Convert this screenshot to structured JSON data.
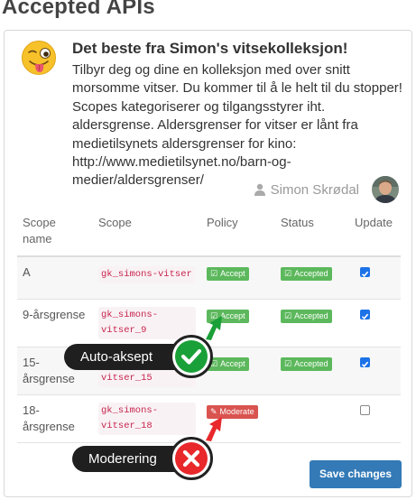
{
  "page": {
    "title": "Accepted APIs"
  },
  "api": {
    "title": "Det beste fra Simon's vitsekolleksjon!",
    "description": "Tilbyr deg og dine en kolleksjon med over snitt morsomme vitser. Du kommer til å le helt til du stopper! Scopes kategoriserer og tilgangsstyrer iht. aldersgrense. Aldersgrenser for vitser er lånt fra medietilsynets aldersgrenser for kino: http://www.medietilsynet.no/barn-og-medier/aldersgrenser/",
    "owner": "Simon Skrødal",
    "emoji_icon": "winking-tongue-emoji-icon"
  },
  "table": {
    "headers": {
      "scope_name": "Scope name",
      "scope": "Scope",
      "policy": "Policy",
      "status": "Status",
      "update": "Update"
    },
    "rows": [
      {
        "name": "A",
        "scope": "gk_simons-vitser",
        "policy": "Accept",
        "status": "Accepted",
        "update_checked": true
      },
      {
        "name": "9-årsgrense",
        "scope": "gk_simons-vitser_9",
        "policy": "Accept",
        "status": "Accepted",
        "update_checked": true
      },
      {
        "name": "15-årsgrense",
        "scope": "gk_simons-vitser_15",
        "policy": "Accept",
        "status": "Accepted",
        "update_checked": true
      },
      {
        "name": "18-årsgrense",
        "scope": "gk_simons-vitser_18",
        "policy": "Moderate",
        "status": "",
        "update_checked": false
      }
    ]
  },
  "actions": {
    "save_label": "Save changes"
  },
  "callouts": {
    "auto": "Auto-aksept",
    "moderation": "Moderering"
  },
  "colors": {
    "accept_green": "#5cb85c",
    "moderate_red": "#d9534f",
    "primary_blue": "#337ab7",
    "checkbox_blue": "#1c73e8",
    "callout_check_green": "#1aa038",
    "callout_x_red": "#e8282b"
  }
}
